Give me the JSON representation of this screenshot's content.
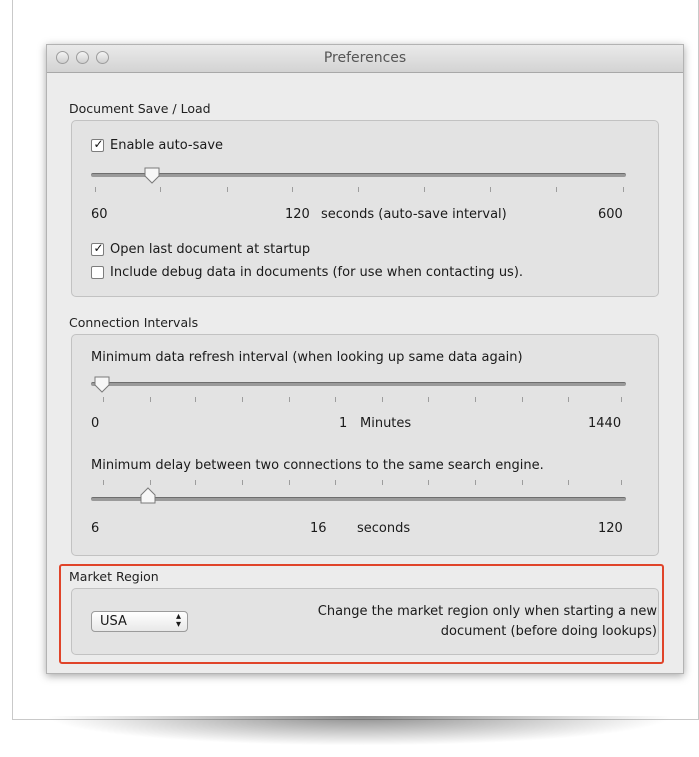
{
  "window": {
    "title": "Preferences"
  },
  "document_save_load": {
    "heading": "Document Save / Load",
    "enable_autosave": {
      "label": "Enable auto-save",
      "checked": true
    },
    "autosave_slider": {
      "min_label": "60",
      "mid_label": "120",
      "unit_label": "seconds (auto-save interval)",
      "max_label": "600",
      "value": 120
    },
    "open_last": {
      "label": "Open last document at startup",
      "checked": true
    },
    "include_debug": {
      "label": "Include debug data in documents (for use when contacting us).",
      "checked": false
    }
  },
  "connection_intervals": {
    "heading": "Connection Intervals",
    "refresh": {
      "label": "Minimum data refresh interval (when looking up same data again)",
      "min_label": "0",
      "mid_label": "1",
      "unit_label": "Minutes",
      "max_label": "1440",
      "value": 1
    },
    "delay": {
      "label": "Minimum delay between two connections to the same search engine.",
      "min_label": "6",
      "mid_label": "16",
      "unit_label": "seconds",
      "max_label": "120",
      "value": 16
    }
  },
  "market_region": {
    "heading": "Market Region",
    "selected": "USA",
    "note_line1": "Change the market region only when starting a new",
    "note_line2": "document (before doing lookups)"
  },
  "colors": {
    "highlight": "#e0442a",
    "window_bg": "#ececec"
  }
}
